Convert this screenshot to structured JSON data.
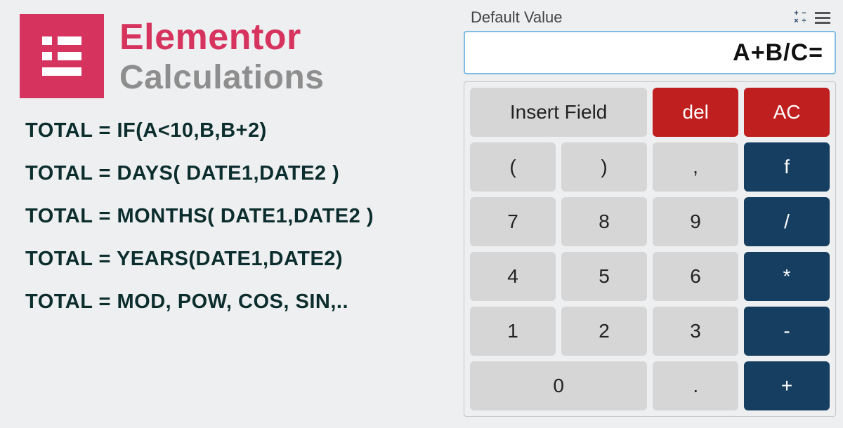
{
  "brand": {
    "title": "Elementor",
    "subtitle": "Calculations"
  },
  "formulas": [
    "TOTAL = IF(A<10,B,B+2)",
    "TOTAL = DAYS( DATE1,DATE2 )",
    "TOTAL = MONTHS( DATE1,DATE2 )",
    "TOTAL = YEARS(DATE1,DATE2)",
    "TOTAL = MOD, POW, COS, SIN,.."
  ],
  "calc": {
    "label": "Default Value",
    "display": "A+B/C=",
    "keys": {
      "insert_field": "Insert Field",
      "del": "del",
      "ac": "AC",
      "lparen": "(",
      "rparen": ")",
      "comma": ",",
      "f": "f",
      "k7": "7",
      "k8": "8",
      "k9": "9",
      "div": "/",
      "k4": "4",
      "k5": "5",
      "k6": "6",
      "mul": "*",
      "k1": "1",
      "k2": "2",
      "k3": "3",
      "sub": "-",
      "k0": "0",
      "dot": ".",
      "add": "+"
    }
  }
}
